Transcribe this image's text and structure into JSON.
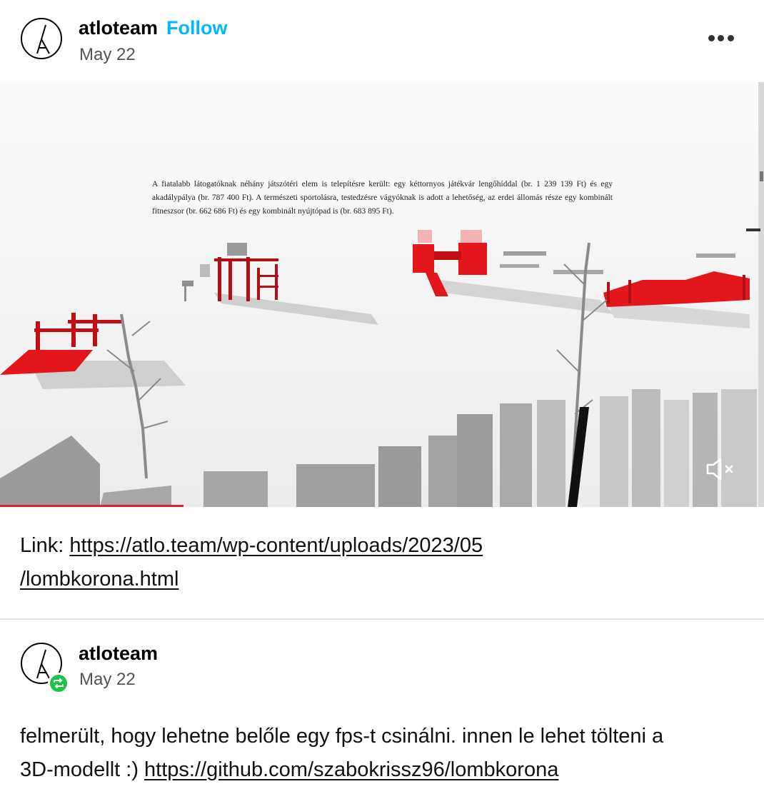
{
  "post": {
    "username": "atloteam",
    "follow_label": "Follow",
    "date": "May 22",
    "more_icon": "more-horizontal-icon",
    "media": {
      "overlay_text": "A fiatalabb látogatóknak néhány játszótéri elem is telepítésre került: egy kéttornyos játékvár lengőhíddal (br. 1 239 139 Ft) és egy akadálypálya (br. 787 400 Ft). A természeti sportolásra, testedzésre vágyóknak is adott a lehetőség, az erdei állomás része egy kombinált fitneszsor (br. 662 686 Ft) és egy kombinált nyújtópad is (br. 683 895 Ft).",
      "mute_icon": "volume-muted-icon",
      "progress": 0.24,
      "accent_color": "#e0202a"
    },
    "link_prefix": "Link: ",
    "link_line1": "https://atlo.team/wp-content/uploads/2023/05",
    "link_line2": "/lombkorona.html"
  },
  "reblog": {
    "username": "atloteam",
    "date": "May 22",
    "badge_icon": "reblog-icon",
    "text_line1": "felmerült, hogy lehetne belőle egy fps-t csinálni. innen le lehet tölteni a",
    "text_line2_prefix": "3D-modellt :) ",
    "link": "https://github.com/szabokrissz96/lombkorona"
  },
  "colors": {
    "follow": "#00b8ff",
    "reblog_badge": "#1fc34a"
  }
}
